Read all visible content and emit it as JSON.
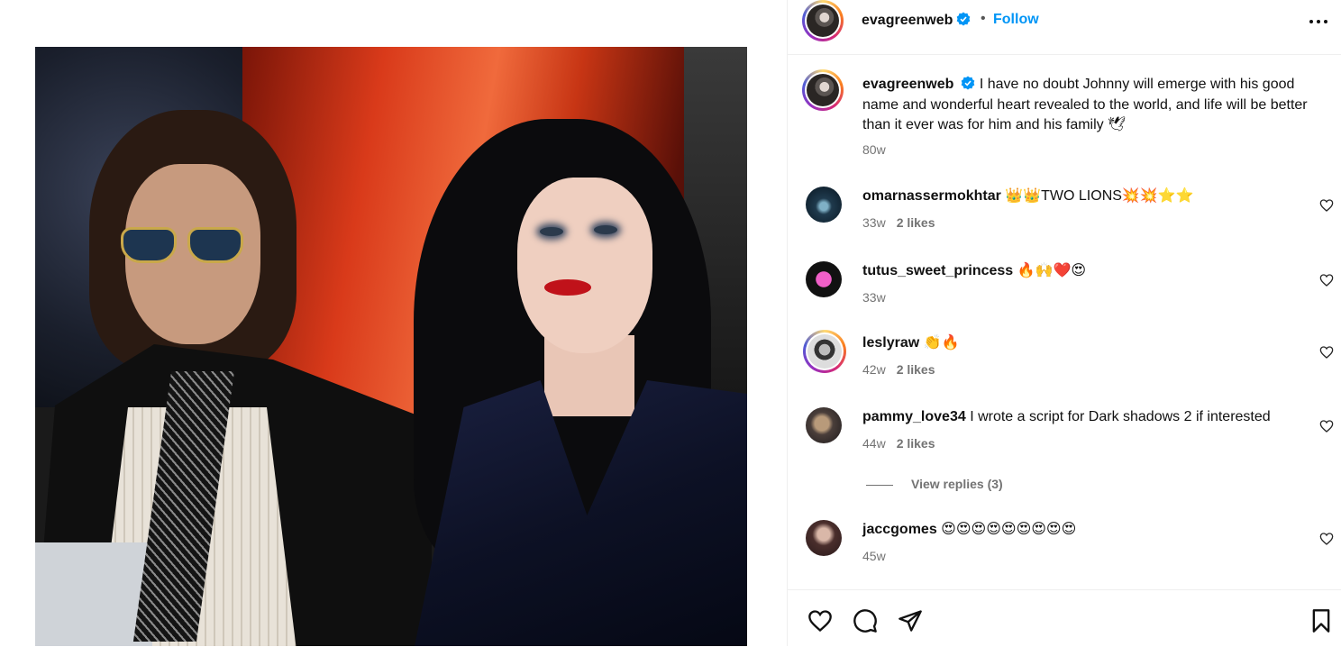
{
  "post": {
    "author": "evagreenweb",
    "follow_label": "Follow",
    "separator": "•",
    "caption": "I have no doubt Johnny will emerge with his good name and wonderful heart revealed to the world, and life will be better than it ever was for him and his family 🕊",
    "caption_time": "80w"
  },
  "comments": [
    {
      "user": "omarnassermokhtar",
      "text": "👑👑TWO LIONS💥💥⭐⭐",
      "time": "33w",
      "likes": "2 likes"
    },
    {
      "user": "tutus_sweet_princess",
      "text": "🔥🙌❤️😍",
      "time": "33w",
      "likes": ""
    },
    {
      "user": "leslyraw",
      "text": "👏🔥",
      "time": "42w",
      "likes": "2 likes"
    },
    {
      "user": "pammy_love34",
      "text": "I wrote a script for Dark shadows 2 if interested",
      "time": "44w",
      "likes": "2 likes"
    },
    {
      "user": "jaccgomes",
      "text": "😍😍😍😍😍😍😍😍😍",
      "time": "45w",
      "likes": ""
    }
  ],
  "view_replies": "View replies (3)",
  "colors": {
    "accent": "#0095f6",
    "meta": "#737373",
    "verified": "#0095f6"
  },
  "icons": [
    "more-icon",
    "verified-icon",
    "heart-icon",
    "comment-icon",
    "share-icon",
    "bookmark-icon"
  ]
}
